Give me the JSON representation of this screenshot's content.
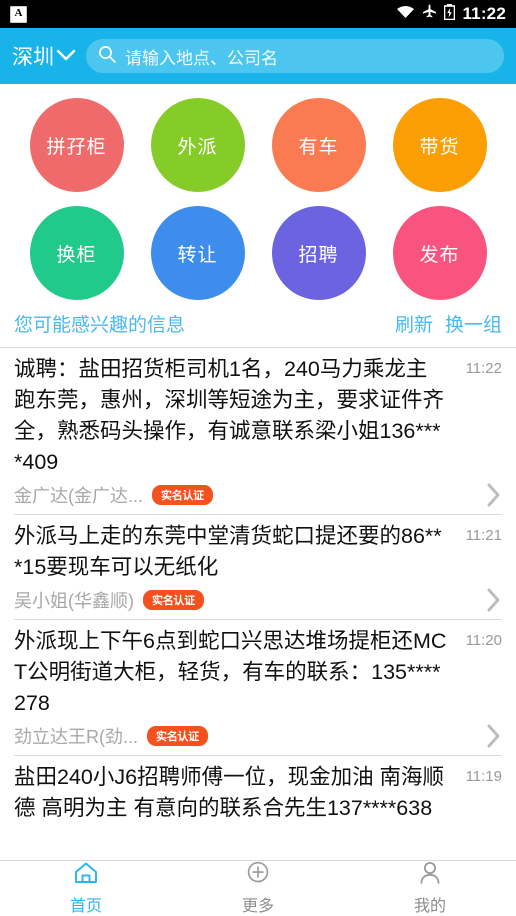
{
  "status_bar": {
    "app_icon": "A",
    "icons": [
      "wifi-icon",
      "airplane-mode-icon",
      "battery-charging-icon"
    ],
    "time": "11:22"
  },
  "header": {
    "city": "深圳",
    "city_chevron": "chevron-down-icon",
    "search_icon": "search-icon",
    "search_value": "",
    "search_placeholder": "请输入地点、公司名",
    "background": "#18b4e9"
  },
  "categories": [
    {
      "label": "拼孖柜",
      "color": "#ef6b6b"
    },
    {
      "label": "外派",
      "color": "#85cc29"
    },
    {
      "label": "有车",
      "color": "#fa7a52"
    },
    {
      "label": "带货",
      "color": "#fa9e04"
    },
    {
      "label": "换柜",
      "color": "#21c98a"
    },
    {
      "label": "转让",
      "color": "#3e8ded"
    },
    {
      "label": "招聘",
      "color": "#6c63e0"
    },
    {
      "label": "发布",
      "color": "#f9537f"
    }
  ],
  "section": {
    "title": "您可能感兴趣的信息",
    "refresh_label": "刷新",
    "shuffle_label": "换一组",
    "accent": "#49b9f2"
  },
  "feed": {
    "items": [
      {
        "text": "诚聘：盐田招货柜司机1名，240马力乘龙主跑东莞，惠州，深圳等短途为主，要求证件齐全，熟悉码头操作，有诚意联系梁小姐136****409",
        "time": "11:22",
        "author": "金广达(金广达...",
        "badge": "实名认证"
      },
      {
        "text": "外派马上走的东莞中堂清货蛇口提还要的86***15要现车可以无纸化",
        "time": "11:21",
        "author": "吴小姐(华鑫顺)",
        "badge": "实名认证"
      },
      {
        "text": "外派现上下午6点到蛇口兴思达堆场提柜还MCT公明街道大柜，轻货，有车的联系：135****278",
        "time": "11:20",
        "author": "劲立达王R(劲...",
        "badge": "实名认证"
      },
      {
        "text": "盐田240小J6招聘师傅一位，现金加油 南海顺德 高明为主 有意向的联系合先生137****638",
        "time": "11:19",
        "author": "",
        "badge": ""
      }
    ],
    "chevron": "chevron-right-icon"
  },
  "tabbar": {
    "items": [
      {
        "label": "首页",
        "icon": "home-icon",
        "active": true
      },
      {
        "label": "更多",
        "icon": "plus-circle-icon",
        "active": false
      },
      {
        "label": "我的",
        "icon": "person-icon",
        "active": false
      }
    ],
    "active_color": "#29b6f2",
    "inactive_color": "#8e8e8e"
  }
}
